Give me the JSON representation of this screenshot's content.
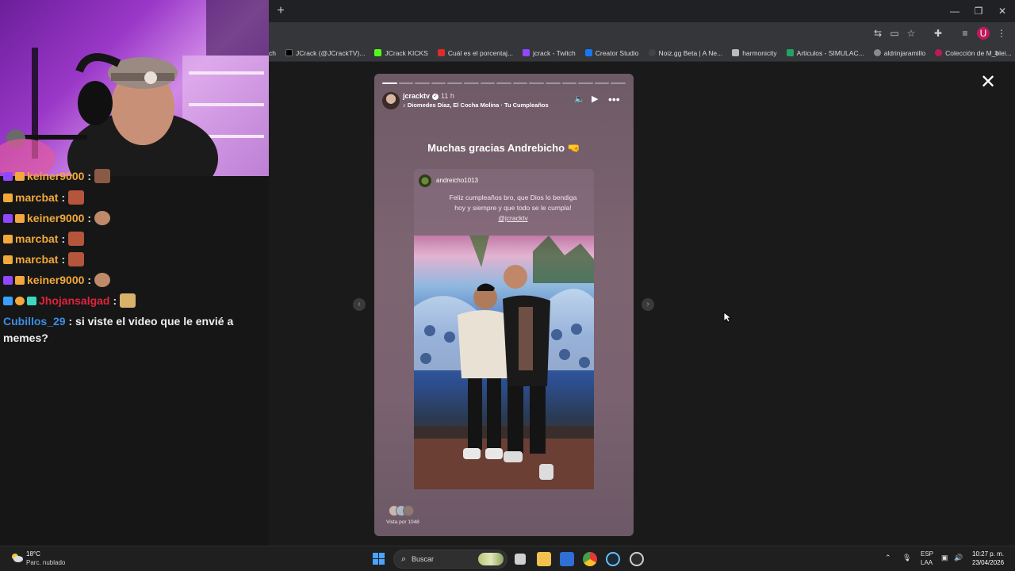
{
  "browser": {
    "new_tab_glyph": "+",
    "window_controls": [
      "—",
      "❐",
      "✕"
    ],
    "bookmarks": [
      {
        "label": "ch",
        "color": "#35363a"
      },
      {
        "label": "JCrack (@JCrackTV)...",
        "color": "#000000"
      },
      {
        "label": "JCrack KICKS",
        "color": "#53fc18"
      },
      {
        "label": "Cuál es el porcentaj...",
        "color": "#e02b2b"
      },
      {
        "label": "jcrack - Twitch",
        "color": "#9146ff"
      },
      {
        "label": "Creator Studio",
        "color": "#1877f2"
      },
      {
        "label": "Noiz.gg Beta | A Ne...",
        "color": "#444444"
      },
      {
        "label": "harmonicity",
        "color": "#bbbbbb"
      },
      {
        "label": "Articulos - SIMULAC...",
        "color": "#1fa463"
      },
      {
        "label": "aldrinjaramillo",
        "color": "#8a8a8a"
      },
      {
        "label": "Colección de M_blei...",
        "color": "#c2185b"
      }
    ],
    "bookmarks_more": "»"
  },
  "chat": {
    "lines": [
      {
        "user": "keiner9000",
        "sep": ":",
        "color": "#f2a93b",
        "badges": [
          "#9146ff",
          "#f2a93b"
        ],
        "emote": "#8a5a44"
      },
      {
        "user": "marcbat",
        "sep": ":",
        "color": "#f2a93b",
        "badges": [
          "#f2a93b"
        ],
        "emote": "#b4553c"
      },
      {
        "user": "keiner9000",
        "sep": ":",
        "color": "#f2a93b",
        "badges": [
          "#9146ff",
          "#f2a93b"
        ],
        "emote": "#c08a6a"
      },
      {
        "user": "marcbat",
        "sep": ":",
        "color": "#f2a93b",
        "badges": [
          "#f2a93b"
        ],
        "emote": "#b4553c"
      },
      {
        "user": "marcbat",
        "sep": ":",
        "color": "#f2a93b",
        "badges": [
          "#f2a93b"
        ],
        "emote": "#b4553c"
      },
      {
        "user": "keiner9000",
        "sep": ":",
        "color": "#f2a93b",
        "badges": [
          "#9146ff",
          "#f2a93b"
        ],
        "emote": "#c08a6a"
      },
      {
        "user": "Jhojansalgad",
        "sep": ":",
        "color": "#e0243c",
        "badges": [
          "#3aa0ff",
          "#f2a93b",
          "#3ed8c0"
        ],
        "emote": "#d8b26a"
      }
    ],
    "message": {
      "user": "Cubillos_29",
      "user_color": "#3a8ee6",
      "text": ": si viste el video que le envié a memes?"
    }
  },
  "story": {
    "progress_total": 15,
    "progress_done": 1,
    "username": "jcracktv",
    "time": "11 h",
    "song": "Diomedes Díaz, El Cocha Molina · Tu Cumpleaños",
    "headline": "Muchas gracias Andrebicho 🤜",
    "quoted_user": "andreicho1013",
    "quoted_caption": "Feliz cumpleaños bro, que Dios lo bendiga hoy y siempre y que todo se le cumpla!",
    "quoted_mention": "@jcracktv",
    "viewers_text": "Vista por 1048",
    "close_glyph": "✕"
  },
  "taskbar": {
    "weather_temp": "18°C",
    "weather_desc": "Parc. nublado",
    "search_placeholder": "Buscar",
    "language": "ESP",
    "layout": "LAA",
    "time": "10:27 p. m.",
    "date": "23/04/2026"
  }
}
